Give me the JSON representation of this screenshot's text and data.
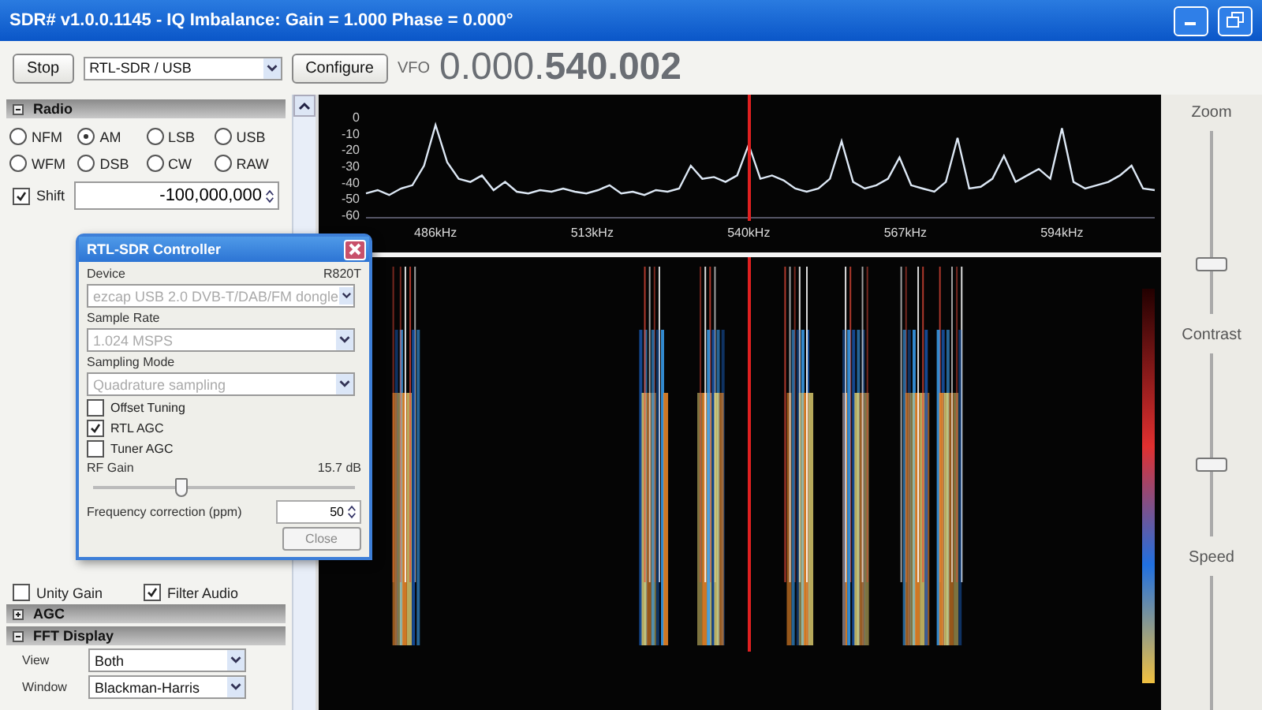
{
  "window": {
    "title": "SDR# v1.0.0.1145 - IQ Imbalance: Gain = 1.000 Phase = 0.000°"
  },
  "toolbar": {
    "stop_button": "Stop",
    "source": "RTL-SDR / USB",
    "configure_button": "Configure",
    "vfo_label": "VFO",
    "frequency": "0.000.**540.002**"
  },
  "radio_panel": {
    "title": "Radio",
    "expanded": true,
    "modes": [
      {
        "label": "NFM",
        "selected": false
      },
      {
        "label": "AM",
        "selected": true
      },
      {
        "label": "LSB",
        "selected": false
      },
      {
        "label": "USB",
        "selected": false
      },
      {
        "label": "WFM",
        "selected": false
      },
      {
        "label": "DSB",
        "selected": false
      },
      {
        "label": "CW",
        "selected": false
      },
      {
        "label": "RAW",
        "selected": false
      }
    ],
    "shift": {
      "label": "Shift",
      "checked": true,
      "value": "-100,000,000"
    }
  },
  "audio_options": [
    {
      "label": "Unity Gain",
      "checked": false
    },
    {
      "label": "Filter Audio",
      "checked": true
    }
  ],
  "sections": [
    {
      "title": "AGC",
      "expanded": false
    },
    {
      "title": "FFT Display",
      "expanded": true
    }
  ],
  "fft_display": {
    "fields": [
      {
        "label": "View",
        "value": "Both"
      },
      {
        "label": "Window",
        "value": "Blackman-Harris"
      }
    ]
  },
  "dialog": {
    "title": "RTL-SDR Controller",
    "device_label": "Device",
    "tuner": "R820T",
    "device": "ezcap USB 2.0 DVB-T/DAB/FM dongle",
    "sample_rate_label": "Sample Rate",
    "sample_rate": "1.024 MSPS",
    "sampling_mode_label": "Sampling Mode",
    "sampling_mode": "Quadrature sampling",
    "options": [
      {
        "label": "Offset Tuning",
        "checked": false
      },
      {
        "label": "RTL AGC",
        "checked": true
      },
      {
        "label": "Tuner AGC",
        "checked": false
      }
    ],
    "rf_gain": {
      "label": "RF Gain",
      "reading": "15.7 dB",
      "level": 0.33
    },
    "correction_label": "Frequency correction (ppm)",
    "correction": "50",
    "close_button": "Close"
  },
  "spectrum": {
    "chart_data": {
      "type": "line",
      "xlim": [
        474,
        610
      ],
      "ylim": [
        -60,
        0
      ],
      "xticks": [
        {
          "value": 486,
          "label": "486kHz"
        },
        {
          "value": 513,
          "label": "513kHz"
        },
        {
          "value": 540,
          "label": "540kHz"
        },
        {
          "value": 567,
          "label": "567kHz"
        },
        {
          "value": 594,
          "label": "594kHz"
        }
      ],
      "yticks": [
        0,
        -10,
        -20,
        -30,
        -40,
        -50,
        -60
      ],
      "x": [
        474,
        476,
        478,
        480,
        482,
        484,
        486,
        488,
        490,
        492,
        494,
        496,
        498,
        500,
        502,
        504,
        506,
        508,
        510,
        512,
        514,
        516,
        518,
        520,
        522,
        524,
        526,
        528,
        530,
        532,
        534,
        536,
        538,
        540,
        542,
        544,
        546,
        548,
        550,
        552,
        554,
        556,
        558,
        560,
        562,
        564,
        566,
        568,
        570,
        572,
        574,
        576,
        578,
        580,
        582,
        584,
        586,
        588,
        590,
        592,
        594,
        596,
        598,
        600,
        602,
        604,
        606,
        608,
        610
      ],
      "series": [
        {
          "color": "#dde8f5",
          "values": [
            -47,
            -45,
            -48,
            -44,
            -42,
            -30,
            -5,
            -28,
            -38,
            -40,
            -36,
            -45,
            -40,
            -46,
            -47,
            -45,
            -46,
            -44,
            -46,
            -47,
            -45,
            -42,
            -47,
            -46,
            -48,
            -45,
            -46,
            -44,
            -30,
            -38,
            -37,
            -40,
            -36,
            -17,
            -38,
            -36,
            -39,
            -44,
            -46,
            -44,
            -38,
            -15,
            -40,
            -44,
            -42,
            -38,
            -25,
            -42,
            -44,
            -46,
            -40,
            -13,
            -44,
            -43,
            -38,
            -24,
            -40,
            -36,
            -32,
            -38,
            -7,
            -40,
            -44,
            -42,
            -40,
            -36,
            -30,
            -44,
            -45
          ]
        }
      ]
    }
  },
  "side_sliders": [
    {
      "label": "Zoom",
      "level": 0.25
    },
    {
      "label": "Contrast",
      "level": 0.38
    },
    {
      "label": "Speed"
    }
  ]
}
